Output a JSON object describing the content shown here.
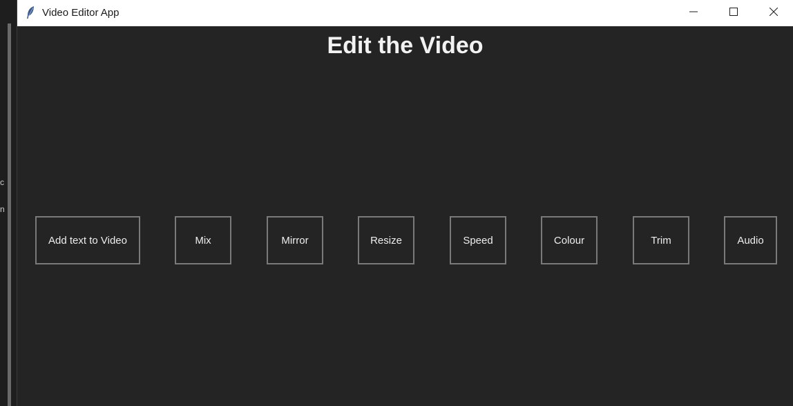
{
  "window": {
    "title": "Video Editor App",
    "icon": "feather-icon"
  },
  "controls": {
    "minimize_icon": "minimize-icon",
    "maximize_icon": "maximize-icon",
    "close_icon": "close-icon"
  },
  "main": {
    "heading": "Edit the Video",
    "buttons": [
      {
        "label": "Add text to Video"
      },
      {
        "label": "Mix"
      },
      {
        "label": "Mirror"
      },
      {
        "label": "Resize"
      },
      {
        "label": "Speed"
      },
      {
        "label": "Colour"
      },
      {
        "label": "Trim"
      },
      {
        "label": "Audio"
      }
    ]
  },
  "background_window": {
    "chars": [
      "c",
      "n"
    ]
  },
  "colors": {
    "window_bg": "#242424",
    "titlebar_bg": "#ffffff",
    "button_border": "#7a7a7a",
    "text": "#eeeeee"
  }
}
